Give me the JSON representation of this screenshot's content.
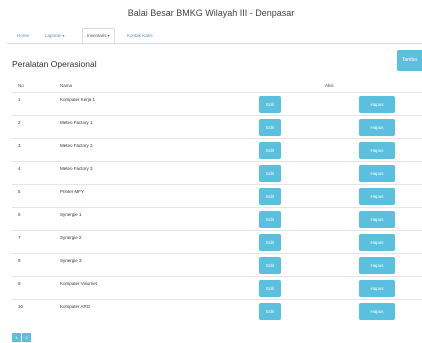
{
  "site": {
    "title": "Balai Besar BMKG Wilayah III - Denpasar"
  },
  "nav": {
    "home": "Home",
    "laporan": "Laporan",
    "inventaris": "Inventaris",
    "kontak": "Kontak Kami",
    "caret": "▾"
  },
  "page": {
    "heading": "Peralatan Operasional",
    "add_label": "Tamba"
  },
  "table": {
    "columns": {
      "no": "No",
      "nama": "Nama",
      "aksi": "Aksi"
    },
    "edit_label": "Edit",
    "hapus_label": "Hapus",
    "rows": [
      {
        "no": "1",
        "nama": "Komputer Kerja 1"
      },
      {
        "no": "2",
        "nama": "Meteo Factory 1"
      },
      {
        "no": "3",
        "nama": "Meteo Factory 2"
      },
      {
        "no": "4",
        "nama": "Meteo Factory 3"
      },
      {
        "no": "5",
        "nama": "Printer MFY"
      },
      {
        "no": "6",
        "nama": "Synergie 1"
      },
      {
        "no": "7",
        "nama": "Synergie 2"
      },
      {
        "no": "8",
        "nama": "Synergie 3"
      },
      {
        "no": "9",
        "nama": "Komputer Visumet"
      },
      {
        "no": "10",
        "nama": "Komputer ARG"
      }
    ]
  },
  "pagination": {
    "pages": [
      "1",
      "2"
    ]
  },
  "colors": {
    "accent": "#5bc0de",
    "link": "#5a8fbd"
  }
}
